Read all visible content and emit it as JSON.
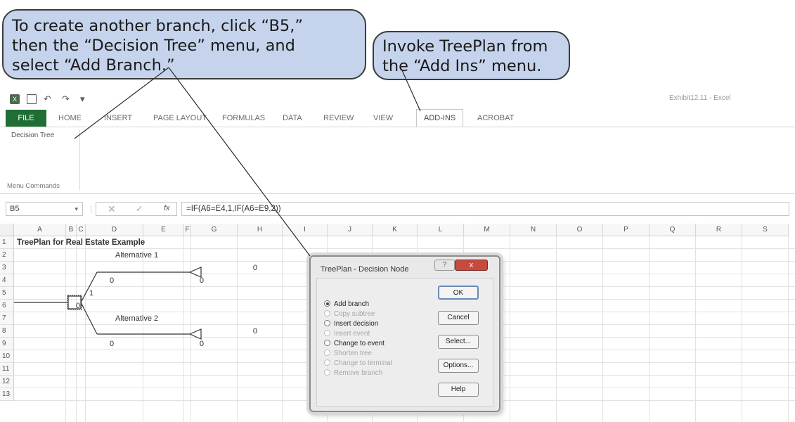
{
  "callouts": {
    "branch": [
      "To create another branch, click “B5,”",
      "then the “Decision Tree” menu, and",
      "select “Add Branch.”"
    ],
    "addins": [
      "Invoke TreePlan from",
      "the “Add Ins” menu."
    ]
  },
  "window": {
    "title": "Exhibit12.11 - Excel"
  },
  "tabs": [
    "FILE",
    "HOME",
    "INSERT",
    "PAGE LAYOUT",
    "FORMULAS",
    "DATA",
    "REVIEW",
    "VIEW",
    "ADD-INS",
    "ACROBAT"
  ],
  "ribbon": {
    "button": "Decision Tree",
    "group": "Menu Commands"
  },
  "formula_bar": {
    "name_box": "B5",
    "fx": "fx",
    "formula": "=IF(A6=E4,1,IF(A6=E9,2))"
  },
  "sheet": {
    "columns": [
      "A",
      "B",
      "C",
      "D",
      "E",
      "F",
      "G",
      "H",
      "I",
      "J",
      "K",
      "L",
      "M",
      "N",
      "O",
      "P",
      "Q",
      "R",
      "S"
    ],
    "rows": [
      "1",
      "2",
      "3",
      "4",
      "5",
      "6",
      "7",
      "8",
      "9",
      "10",
      "11",
      "12",
      "13"
    ],
    "cells": {
      "A1": "TreePlan for Real Estate Example",
      "D2": "Alternative 1",
      "G3": "0",
      "D4": "0",
      "E4": "0",
      "B5": "1",
      "A6": "0",
      "D7": "Alternative 2",
      "G8": "0",
      "D9": "0",
      "E9": "0"
    }
  },
  "dialog": {
    "title": "TreePlan - Decision Node",
    "help_glyph": "?",
    "close_glyph": "x",
    "options": [
      {
        "label": "Add branch",
        "state": "selected"
      },
      {
        "label": "Copy subtree",
        "state": "disabled"
      },
      {
        "label": "Insert decision",
        "state": "enabled"
      },
      {
        "label": "Insert event",
        "state": "disabled"
      },
      {
        "label": "Change to event",
        "state": "enabled"
      },
      {
        "label": "Shorten tree",
        "state": "disabled"
      },
      {
        "label": "Change to terminal",
        "state": "disabled"
      },
      {
        "label": "Remove branch",
        "state": "disabled"
      }
    ],
    "buttons": [
      "OK",
      "Cancel",
      "Select...",
      "Options...",
      "Help"
    ]
  },
  "colors": {
    "callout_fill": "#c5d4ec",
    "file_tab": "#1f6e35",
    "close_button": "#c74a3e"
  }
}
